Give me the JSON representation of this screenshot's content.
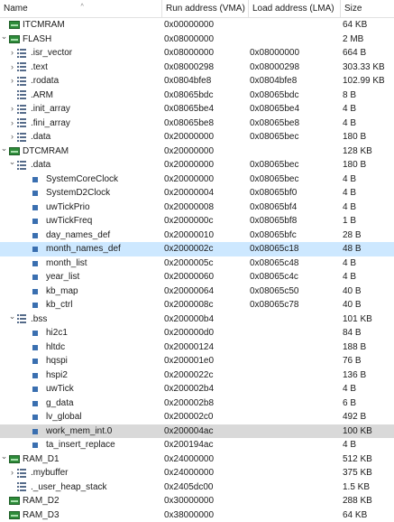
{
  "columns": {
    "name": "Name",
    "run": "Run address (VMA)",
    "load": "Load address (LMA)",
    "size": "Size"
  },
  "rows": [
    {
      "name": "ITCMRAM",
      "run": "0x00000000",
      "load": "",
      "size": "64 KB",
      "kind": "memory",
      "level": 0,
      "chevron": "",
      "state": ""
    },
    {
      "name": "FLASH",
      "run": "0x08000000",
      "load": "",
      "size": "2 MB",
      "kind": "memory",
      "level": 0,
      "chevron": "expanded",
      "state": ""
    },
    {
      "name": ".isr_vector",
      "run": "0x08000000",
      "load": "0x08000000",
      "size": "664 B",
      "kind": "section",
      "level": 1,
      "chevron": "collapsed",
      "state": ""
    },
    {
      "name": ".text",
      "run": "0x08000298",
      "load": "0x08000298",
      "size": "303.33 KB",
      "kind": "section",
      "level": 1,
      "chevron": "collapsed",
      "state": ""
    },
    {
      "name": ".rodata",
      "run": "0x0804bfe8",
      "load": "0x0804bfe8",
      "size": "102.99 KB",
      "kind": "section",
      "level": 1,
      "chevron": "collapsed",
      "state": ""
    },
    {
      "name": ".ARM",
      "run": "0x08065bdc",
      "load": "0x08065bdc",
      "size": "8 B",
      "kind": "section",
      "level": 1,
      "chevron": "",
      "state": ""
    },
    {
      "name": ".init_array",
      "run": "0x08065be4",
      "load": "0x08065be4",
      "size": "4 B",
      "kind": "section",
      "level": 1,
      "chevron": "collapsed",
      "state": ""
    },
    {
      "name": ".fini_array",
      "run": "0x08065be8",
      "load": "0x08065be8",
      "size": "4 B",
      "kind": "section",
      "level": 1,
      "chevron": "collapsed",
      "state": ""
    },
    {
      "name": ".data",
      "run": "0x20000000",
      "load": "0x08065bec",
      "size": "180 B",
      "kind": "section",
      "level": 1,
      "chevron": "collapsed",
      "state": ""
    },
    {
      "name": "DTCMRAM",
      "run": "0x20000000",
      "load": "",
      "size": "128 KB",
      "kind": "memory",
      "level": 0,
      "chevron": "expanded",
      "state": ""
    },
    {
      "name": ".data",
      "run": "0x20000000",
      "load": "0x08065bec",
      "size": "180 B",
      "kind": "section",
      "level": 1,
      "chevron": "expanded",
      "state": ""
    },
    {
      "name": "SystemCoreClock",
      "run": "0x20000000",
      "load": "0x08065bec",
      "size": "4 B",
      "kind": "symbol",
      "level": 2,
      "chevron": "",
      "state": ""
    },
    {
      "name": "SystemD2Clock",
      "run": "0x20000004",
      "load": "0x08065bf0",
      "size": "4 B",
      "kind": "symbol",
      "level": 2,
      "chevron": "",
      "state": ""
    },
    {
      "name": "uwTickPrio",
      "run": "0x20000008",
      "load": "0x08065bf4",
      "size": "4 B",
      "kind": "symbol",
      "level": 2,
      "chevron": "",
      "state": ""
    },
    {
      "name": "uwTickFreq",
      "run": "0x2000000c",
      "load": "0x08065bf8",
      "size": "1 B",
      "kind": "symbol",
      "level": 2,
      "chevron": "",
      "state": ""
    },
    {
      "name": "day_names_def",
      "run": "0x20000010",
      "load": "0x08065bfc",
      "size": "28 B",
      "kind": "symbol",
      "level": 2,
      "chevron": "",
      "state": ""
    },
    {
      "name": "month_names_def",
      "run": "0x2000002c",
      "load": "0x08065c18",
      "size": "48 B",
      "kind": "symbol",
      "level": 2,
      "chevron": "",
      "state": "hover"
    },
    {
      "name": "month_list",
      "run": "0x2000005c",
      "load": "0x08065c48",
      "size": "4 B",
      "kind": "symbol",
      "level": 2,
      "chevron": "",
      "state": ""
    },
    {
      "name": "year_list",
      "run": "0x20000060",
      "load": "0x08065c4c",
      "size": "4 B",
      "kind": "symbol",
      "level": 2,
      "chevron": "",
      "state": ""
    },
    {
      "name": "kb_map",
      "run": "0x20000064",
      "load": "0x08065c50",
      "size": "40 B",
      "kind": "symbol",
      "level": 2,
      "chevron": "",
      "state": ""
    },
    {
      "name": "kb_ctrl",
      "run": "0x2000008c",
      "load": "0x08065c78",
      "size": "40 B",
      "kind": "symbol",
      "level": 2,
      "chevron": "",
      "state": ""
    },
    {
      "name": ".bss",
      "run": "0x200000b4",
      "load": "",
      "size": "101 KB",
      "kind": "section",
      "level": 1,
      "chevron": "expanded",
      "state": ""
    },
    {
      "name": "hi2c1",
      "run": "0x200000d0",
      "load": "",
      "size": "84 B",
      "kind": "symbol",
      "level": 2,
      "chevron": "",
      "state": ""
    },
    {
      "name": "hltdc",
      "run": "0x20000124",
      "load": "",
      "size": "188 B",
      "kind": "symbol",
      "level": 2,
      "chevron": "",
      "state": ""
    },
    {
      "name": "hqspi",
      "run": "0x200001e0",
      "load": "",
      "size": "76 B",
      "kind": "symbol",
      "level": 2,
      "chevron": "",
      "state": ""
    },
    {
      "name": "hspi2",
      "run": "0x2000022c",
      "load": "",
      "size": "136 B",
      "kind": "symbol",
      "level": 2,
      "chevron": "",
      "state": ""
    },
    {
      "name": "uwTick",
      "run": "0x200002b4",
      "load": "",
      "size": "4 B",
      "kind": "symbol",
      "level": 2,
      "chevron": "",
      "state": ""
    },
    {
      "name": "g_data",
      "run": "0x200002b8",
      "load": "",
      "size": "6 B",
      "kind": "symbol",
      "level": 2,
      "chevron": "",
      "state": ""
    },
    {
      "name": "lv_global",
      "run": "0x200002c0",
      "load": "",
      "size": "492 B",
      "kind": "symbol",
      "level": 2,
      "chevron": "",
      "state": ""
    },
    {
      "name": "work_mem_int.0",
      "run": "0x200004ac",
      "load": "",
      "size": "100 KB",
      "kind": "symbol",
      "level": 2,
      "chevron": "",
      "state": "selected"
    },
    {
      "name": "ta_insert_replace",
      "run": "0x200194ac",
      "load": "",
      "size": "4 B",
      "kind": "symbol",
      "level": 2,
      "chevron": "",
      "state": ""
    },
    {
      "name": "RAM_D1",
      "run": "0x24000000",
      "load": "",
      "size": "512 KB",
      "kind": "memory",
      "level": 0,
      "chevron": "expanded",
      "state": ""
    },
    {
      "name": ".mybuffer",
      "run": "0x24000000",
      "load": "",
      "size": "375 KB",
      "kind": "section",
      "level": 1,
      "chevron": "collapsed",
      "state": ""
    },
    {
      "name": "._user_heap_stack",
      "run": "0x2405dc00",
      "load": "",
      "size": "1.5 KB",
      "kind": "section",
      "level": 1,
      "chevron": "",
      "state": ""
    },
    {
      "name": "RAM_D2",
      "run": "0x30000000",
      "load": "",
      "size": "288 KB",
      "kind": "memory",
      "level": 0,
      "chevron": "",
      "state": ""
    },
    {
      "name": "RAM_D3",
      "run": "0x38000000",
      "load": "",
      "size": "64 KB",
      "kind": "memory",
      "level": 0,
      "chevron": "",
      "state": ""
    }
  ]
}
